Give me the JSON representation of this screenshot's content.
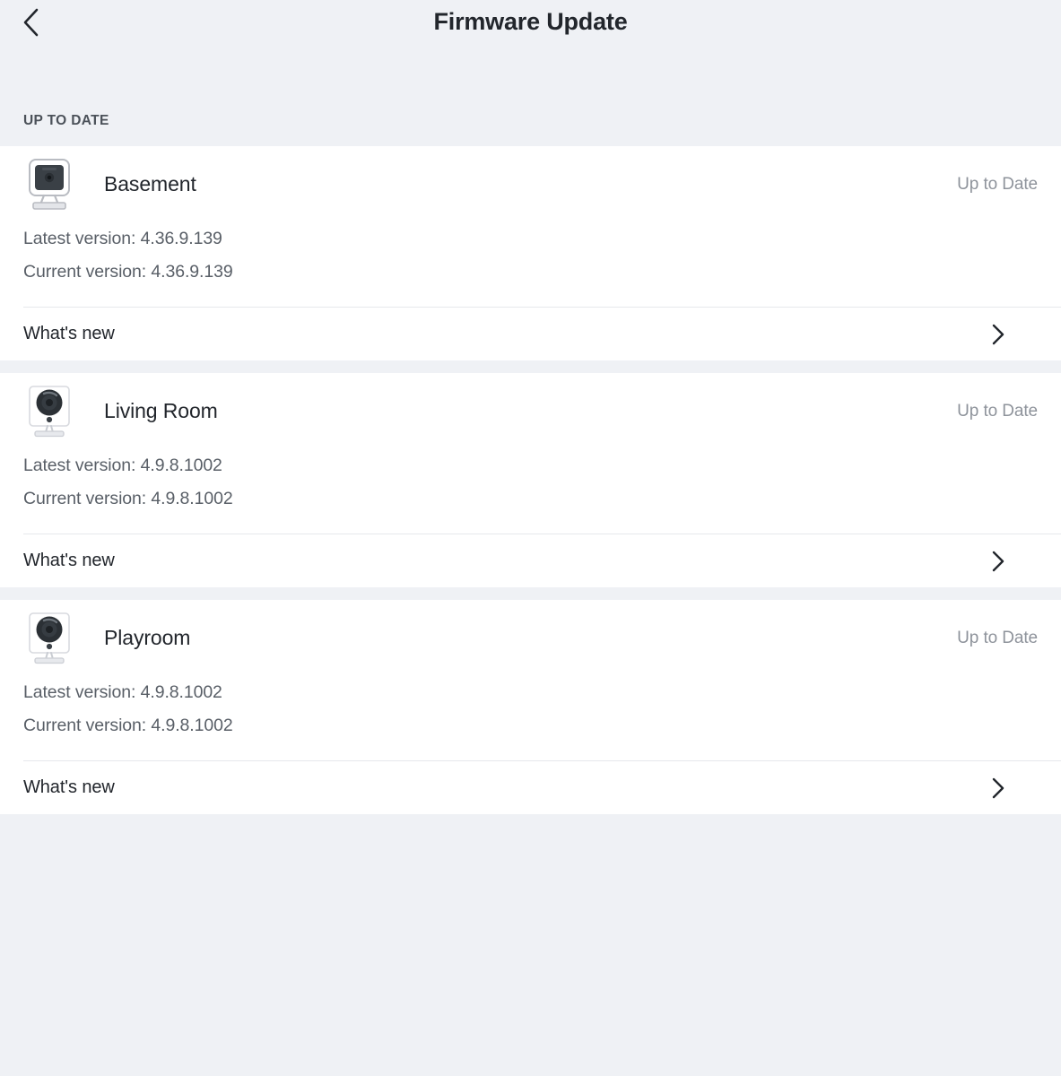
{
  "header": {
    "title": "Firmware Update",
    "back_icon": "chevron-left-icon"
  },
  "section": {
    "label": "UP TO DATE"
  },
  "labels": {
    "whats_new": "What's new",
    "latest_prefix": "Latest version: ",
    "current_prefix": "Current version: ",
    "chevron_icon": "chevron-right-icon"
  },
  "devices": [
    {
      "name": "Basement",
      "status": "Up to Date",
      "icon": "camera-square-monitor-icon",
      "latest_version": "Latest version: 4.36.9.139",
      "current_version": "Current version: 4.36.9.139",
      "whats_new": "What's new"
    },
    {
      "name": "Living Room",
      "status": "Up to Date",
      "icon": "camera-pan-icon",
      "latest_version": "Latest version: 4.9.8.1002",
      "current_version": "Current version: 4.9.8.1002",
      "whats_new": "What's new"
    },
    {
      "name": "Playroom",
      "status": "Up to Date",
      "icon": "camera-pan-icon",
      "latest_version": "Latest version: 4.9.8.1002",
      "current_version": "Current version: 4.9.8.1002",
      "whats_new": "What's new"
    }
  ],
  "colors": {
    "background": "#eff1f5",
    "card": "#ffffff",
    "text_primary": "#22262c",
    "text_secondary": "#595f67",
    "text_muted": "#8e939b",
    "divider": "#e6e8ec"
  }
}
